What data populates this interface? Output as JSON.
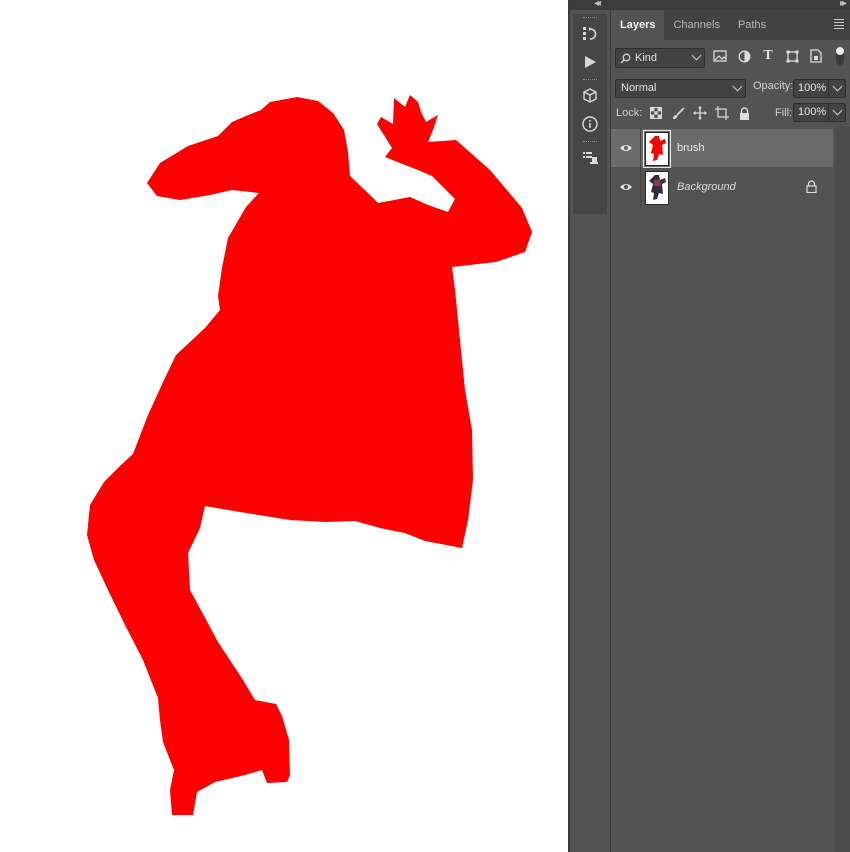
{
  "canvas": {
    "background_color": "#ffffff",
    "fill_color": "#ff0000"
  },
  "panel": {
    "tabs": [
      {
        "label": "Layers",
        "active": true
      },
      {
        "label": "Channels",
        "active": false
      },
      {
        "label": "Paths",
        "active": false
      }
    ],
    "filter": {
      "kind_label": "Kind",
      "icons": [
        "image-filter-icon",
        "adjustment-filter-icon",
        "type-filter-icon",
        "shape-filter-icon",
        "smart-object-filter-icon"
      ]
    },
    "blend_mode": "Normal",
    "opacity_label": "Opacity:",
    "opacity_value": "100%",
    "lock_label": "Lock:",
    "lock_icons": [
      "lock-transparent-pixels-icon",
      "lock-image-pixels-icon",
      "lock-position-icon",
      "lock-artboard-icon",
      "lock-all-icon"
    ],
    "fill_label": "Fill:",
    "fill_value": "100%",
    "layers": [
      {
        "name": "brush",
        "selected": true,
        "visible": true,
        "locked": false
      },
      {
        "name": "Background",
        "selected": false,
        "visible": true,
        "locked": true
      }
    ]
  },
  "tools": [
    "history-icon",
    "actions-play-icon",
    "3d-icon",
    "info-icon",
    "properties-icon"
  ],
  "colors": {
    "panel_bg": "#535353",
    "panel_dark": "#424242",
    "selected_layer": "#6b6b6b",
    "text": "#e4e4e4"
  }
}
